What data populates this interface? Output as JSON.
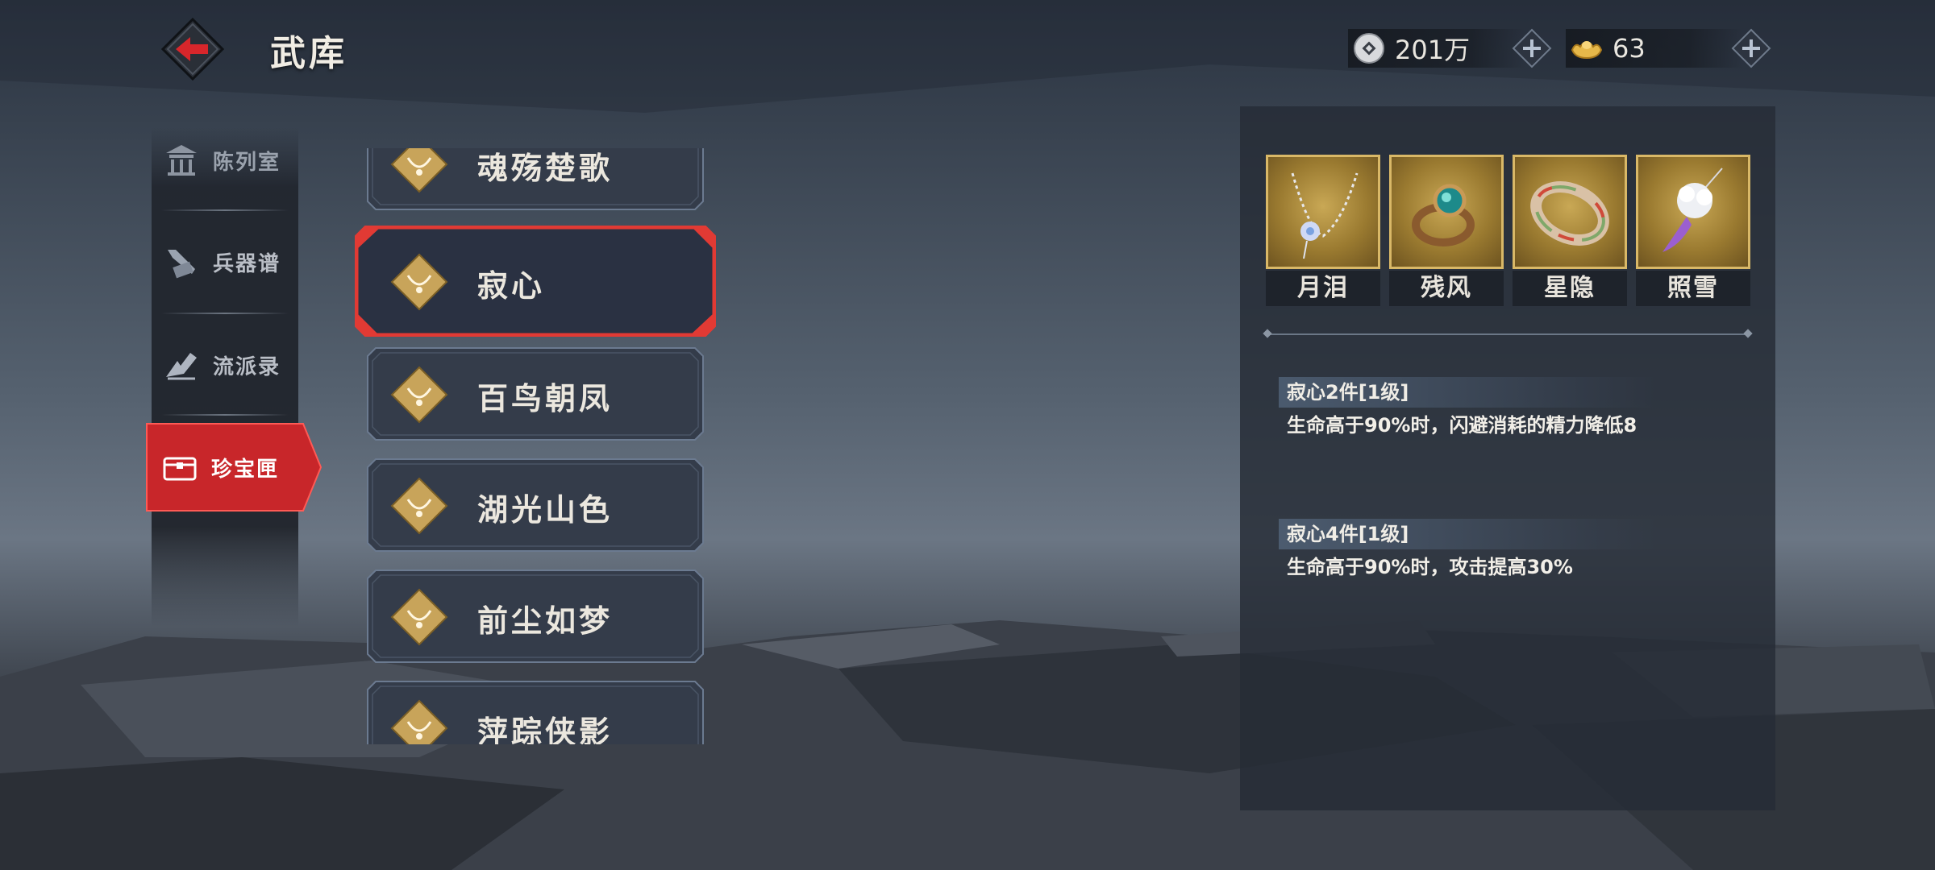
{
  "header": {
    "title": "武库",
    "silver_amount": "201万",
    "gold_amount": "63"
  },
  "nav": {
    "items": [
      {
        "label": "陈列室",
        "icon": "pavilion-icon"
      },
      {
        "label": "兵器谱",
        "icon": "weapon-scroll-icon"
      },
      {
        "label": "流派录",
        "icon": "school-record-icon"
      },
      {
        "label": "珍宝匣",
        "icon": "treasure-chest-icon"
      }
    ],
    "active_index": 3
  },
  "sets": {
    "items": [
      {
        "label": "魂殇楚歌"
      },
      {
        "label": "寂心"
      },
      {
        "label": "百鸟朝凤"
      },
      {
        "label": "湖光山色"
      },
      {
        "label": "前尘如梦"
      },
      {
        "label": "萍踪侠影"
      }
    ],
    "selected_index": 1
  },
  "detail": {
    "pieces": [
      {
        "name": "月泪",
        "icon": "necklace-icon"
      },
      {
        "name": "残风",
        "icon": "ring-icon"
      },
      {
        "name": "星隐",
        "icon": "bracelet-icon"
      },
      {
        "name": "照雪",
        "icon": "pendant-icon"
      }
    ],
    "effects": [
      {
        "title": "寂心2件[1级]",
        "desc": "生命高于90%时，闪避消耗的精力降低8"
      },
      {
        "title": "寂心4件[1级]",
        "desc": "生命高于90%时，攻击提高30%"
      }
    ]
  },
  "colors": {
    "accent_red": "#d2262a",
    "gold": "#d9b867",
    "panel": "#262c36"
  }
}
